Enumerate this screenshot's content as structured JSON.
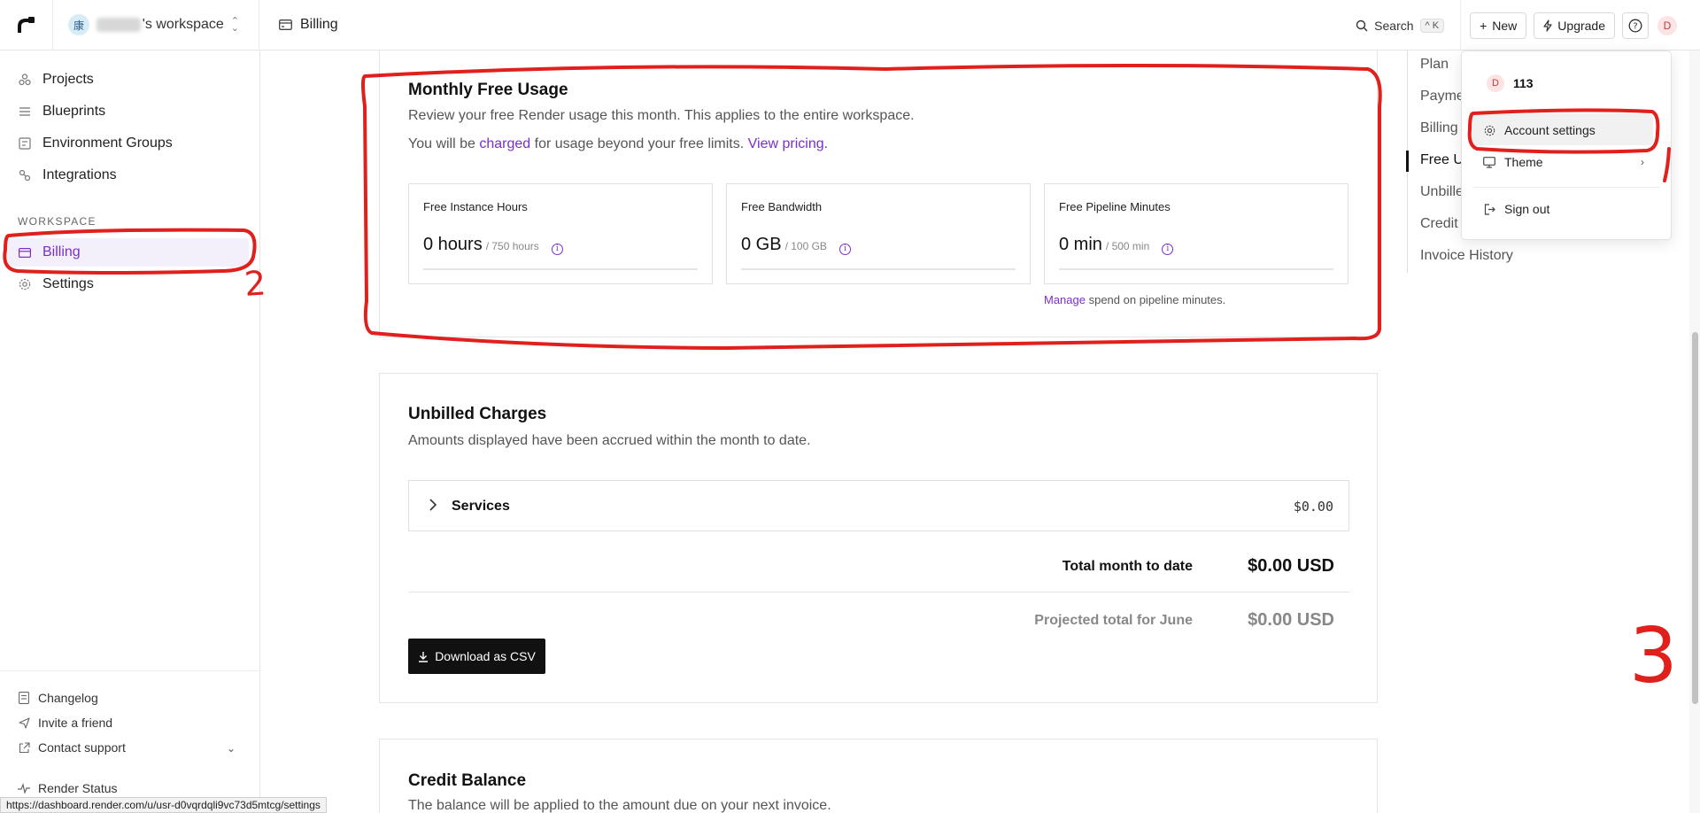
{
  "topbar": {
    "workspace_initial": "康",
    "workspace_name": "'s workspace",
    "page_title": "Billing",
    "search_label": "Search",
    "search_shortcut": "^ K",
    "new_label": "New",
    "upgrade_label": "Upgrade",
    "user_initial": "D"
  },
  "sidebar": {
    "items": [
      {
        "label": "Projects",
        "icon": "projects-icon"
      },
      {
        "label": "Blueprints",
        "icon": "blueprints-icon"
      },
      {
        "label": "Environment Groups",
        "icon": "environment-groups-icon"
      },
      {
        "label": "Integrations",
        "icon": "integrations-icon"
      }
    ],
    "section_label": "WORKSPACE",
    "workspace_items": [
      {
        "label": "Billing",
        "icon": "billing-icon",
        "active": true
      },
      {
        "label": "Settings",
        "icon": "gear-icon"
      }
    ],
    "footer": [
      {
        "label": "Changelog",
        "icon": "changelog-icon"
      },
      {
        "label": "Invite a friend",
        "icon": "send-icon"
      },
      {
        "label": "Contact support",
        "icon": "external-link-icon"
      },
      {
        "label": "Render Status",
        "icon": "pulse-icon"
      }
    ]
  },
  "free_usage": {
    "title": "Monthly Free Usage",
    "description": "Review your free Render usage this month. This applies to the entire workspace.",
    "charge_prefix": "You will be ",
    "charge_link": "charged",
    "charge_middle": " for usage beyond your free limits. ",
    "pricing_link": "View pricing",
    "charge_suffix": ".",
    "metrics": [
      {
        "label": "Free Instance Hours",
        "value": "0 hours",
        "limit": "/ 750 hours",
        "used_fraction": 0
      },
      {
        "label": "Free Bandwidth",
        "value": "0 GB",
        "limit": "/ 100 GB",
        "used_fraction": 0
      },
      {
        "label": "Free Pipeline Minutes",
        "value": "0 min",
        "limit": "/ 500 min",
        "used_fraction": 0
      }
    ],
    "manage_link": "Manage",
    "manage_suffix": " spend on pipeline minutes."
  },
  "unbilled": {
    "title": "Unbilled Charges",
    "description": "Amounts displayed have been accrued within the month to date.",
    "services_label": "Services",
    "services_amount": "$0.00",
    "total_label": "Total month to date",
    "total_value": "$0.00 USD",
    "projected_label": "Projected total for June",
    "projected_value": "$0.00 USD",
    "download_label": "Download as CSV"
  },
  "credit": {
    "title": "Credit Balance",
    "description": "The balance will be applied to the amount due on your next invoice."
  },
  "right_nav": {
    "items": [
      "Plan",
      "Payme",
      "Billing",
      "Free U",
      "Unbille",
      "Credit",
      "Invoice History"
    ],
    "active_index": 3
  },
  "dropdown": {
    "user_initial": "D",
    "username": "113",
    "account_settings": "Account settings",
    "theme": "Theme",
    "sign_out": "Sign out"
  },
  "status_url": "https://dashboard.render.com/u/usr-d0vqrdqli9vc73d5mtcg/settings",
  "annotations": {
    "label_2": "2",
    "label_3": "3",
    "color": "#e0201c"
  },
  "colors": {
    "accent": "#7a2fc9",
    "annotation": "#e0201c"
  }
}
